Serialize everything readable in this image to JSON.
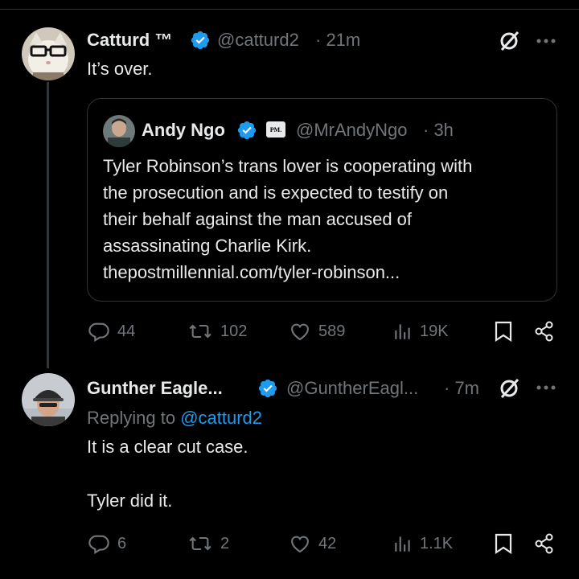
{
  "tweet1": {
    "name": "Catturd ™",
    "handle": "@catturd2",
    "time": "· 21m",
    "text": "It’s over.",
    "quote": {
      "name": "Andy Ngo",
      "badge": "PM.",
      "handle": "@MrAndyNgo",
      "time": "· 3h",
      "lines": [
        "Tyler Robinson’s trans lover is cooperating with",
        "the prosecution and is expected to testify on",
        "their behalf against the man accused of",
        "assassinating Charlie Kirk.",
        "thepostmillennial.com/tyler-robinson..."
      ]
    },
    "stats": {
      "replies": "44",
      "reposts": "102",
      "likes": "589",
      "views": "19K"
    }
  },
  "tweet2": {
    "name": "Gunther Eagle...",
    "handle": "@GuntherEagl...",
    "time": "· 7m",
    "replying_prefix": "Replying to ",
    "replying_to": "@catturd2",
    "line1": "It is a clear cut case.",
    "line2": "Tyler did it.",
    "stats": {
      "replies": "6",
      "reposts": "2",
      "likes": "42",
      "views": "1.1K"
    }
  },
  "icons": {
    "verified": "verified-badge-icon",
    "grok": "grok-icon",
    "more": "more-dots-icon",
    "reply": "reply-icon",
    "repost": "repost-icon",
    "like": "heart-icon",
    "views": "views-icon",
    "bookmark": "bookmark-icon",
    "share": "share-icon"
  },
  "colors": {
    "accent": "#1d9bf0",
    "muted": "#71767b",
    "text": "#e7e9ea",
    "border": "#2f3336"
  }
}
